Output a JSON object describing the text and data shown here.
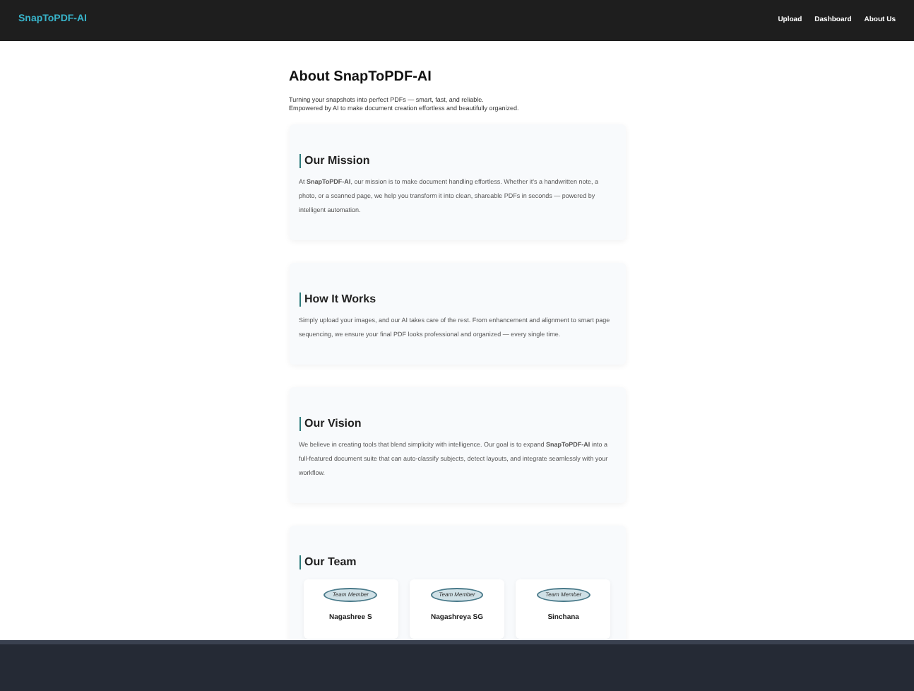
{
  "navbar": {
    "brand": "SnapToPDF-AI",
    "links": [
      "Upload",
      "Dashboard",
      "About Us"
    ]
  },
  "page": {
    "title": "About SnapToPDF-AI",
    "intro": [
      "Turning your snapshots into perfect PDFs — smart, fast, and reliable.",
      "Empowered by AI to make document creation effortless and beautifully organized."
    ]
  },
  "sections": [
    {
      "kind": "text",
      "heading": "Our Mission",
      "body": "At **SnapToPDF-AI**, our mission is to make document handling effortless. Whether it's a handwritten note, a photo, or a scanned page, we help you transform it into clean, shareable PDFs in seconds — powered by intelligent automation."
    },
    {
      "kind": "text",
      "heading": "How It Works",
      "body": "Simply upload your images, and our AI takes care of the rest. From enhancement and alignment to smart page sequencing, we ensure your final PDF looks professional and organized — every single time."
    },
    {
      "kind": "text",
      "heading": "Our Vision",
      "body": "We believe in creating tools that blend simplicity with intelligence. Our goal is to expand **SnapToPDF-AI** into a full-featured document suite that can auto-classify subjects, detect layouts, and integrate seamlessly with your workflow."
    },
    {
      "kind": "team",
      "heading": "Our Team",
      "members": [
        {
          "image_alt": "Team Member",
          "name": "Nagashree S"
        },
        {
          "image_alt": "Team Member",
          "name": "Nagashreya SG"
        },
        {
          "image_alt": "Team Member",
          "name": "Sinchana"
        }
      ]
    }
  ]
}
